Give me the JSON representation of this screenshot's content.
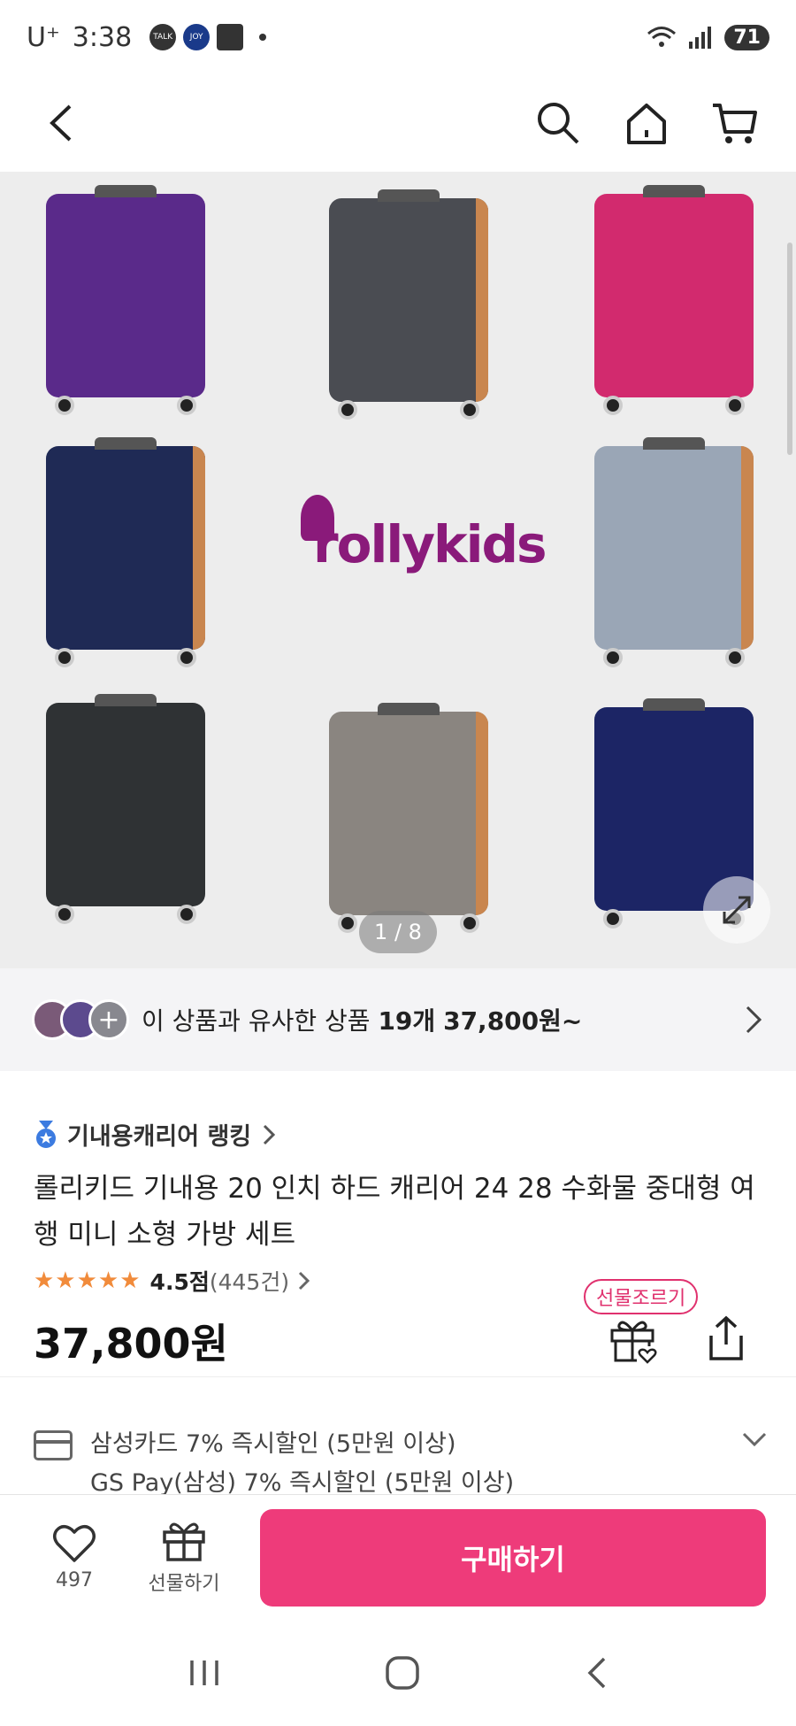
{
  "status_bar": {
    "carrier": "U⁺",
    "time": "3:38",
    "apps": [
      "TALK",
      "JOY",
      "shop"
    ],
    "battery": "71"
  },
  "header": {
    "back_icon": "chevron-left-icon",
    "search_icon": "search-icon",
    "home_icon": "home-icon",
    "cart_icon": "cart-icon"
  },
  "gallery": {
    "brand_logo": "rollykids",
    "counter": "1 / 8",
    "suitcases": [
      {
        "color": "#5a2a8a",
        "style": "stripes"
      },
      {
        "color": "#4a4c52",
        "style": "cross"
      },
      {
        "color": "#d22a6e",
        "style": "stripes"
      },
      {
        "color": "#1f2a55",
        "style": "cross"
      },
      {
        "color": "#9aa6b6",
        "style": "cross"
      },
      {
        "color": "#2f3234",
        "style": "stripes"
      },
      {
        "color": "#8a8580",
        "style": "cross"
      },
      {
        "color": "#1c2565",
        "style": "stripes"
      }
    ]
  },
  "similar": {
    "text_prefix": "이 상품과 유사한 상품 ",
    "count": "19개",
    "price": "37,800원~"
  },
  "product": {
    "ranking_label": "기내용캐리어 랭킹",
    "title": "롤리키드 기내용 20 인치 하드 캐리어 24 28 수화물 중대형 여행 미니 소형 가방 세트",
    "stars": "★★★★★",
    "rating": "4.5점",
    "review_count": "(445건)",
    "price": "37,800원",
    "gift_badge": "선물조르기"
  },
  "benefits": {
    "line1": "삼성카드 7% 즉시할인 (5만원 이상)",
    "line2": "GS Pay(삼성) 7% 즉시할인 (5만원 이상)"
  },
  "bottom_bar": {
    "like_count": "497",
    "gift_label": "선물하기",
    "buy_label": "구매하기"
  },
  "colors": {
    "accent": "#ee3b7a",
    "star": "#f18b3b"
  }
}
